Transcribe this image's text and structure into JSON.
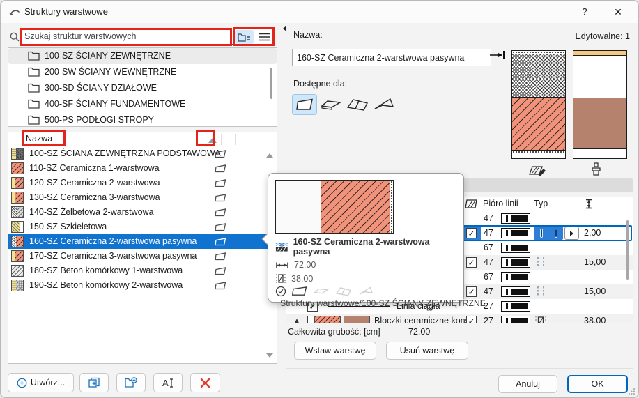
{
  "window": {
    "title": "Struktury warstwowe",
    "help_label": "?",
    "close_label": "✕"
  },
  "search": {
    "placeholder": "Szukaj struktur warstwowych"
  },
  "folder_tree": {
    "items": [
      {
        "label": "100-SZ ŚCIANY ZEWNĘTRZNE",
        "selected": true
      },
      {
        "label": "200-SW ŚCIANY WEWNĘTRZNE",
        "selected": false
      },
      {
        "label": "300-SD ŚCIANY DZIAŁOWE",
        "selected": false
      },
      {
        "label": "400-SF ŚCIANY FUNDAMENTOWE",
        "selected": false
      },
      {
        "label": "500-PS PODŁOGI STROPY",
        "selected": false
      }
    ]
  },
  "list": {
    "header": "Nazwa",
    "items": [
      {
        "name": "100-SZ ŚCIANA ZEWNĘTRZNA PODSTAWOWA",
        "pattern": "yellow-dark",
        "selected": false
      },
      {
        "name": "110-SZ Ceramiczna 1-warstwowa",
        "pattern": "salmon",
        "selected": false
      },
      {
        "name": "120-SZ Ceramiczna 2-warstwowa",
        "pattern": "yellow-salmon",
        "selected": false
      },
      {
        "name": "130-SZ Ceramiczna  3-warstwowa",
        "pattern": "yellow-salmon",
        "selected": false
      },
      {
        "name": "140-SZ Żelbetowa  2-warstwowa",
        "pattern": "mesh-gray",
        "selected": false
      },
      {
        "name": "150-SZ Szkieletowa",
        "pattern": "yellow-mesh",
        "selected": false
      },
      {
        "name": "160-SZ Ceramiczna 2-warstwowa pasywna",
        "pattern": "mesh-salmon",
        "selected": true
      },
      {
        "name": "170-SZ Ceramiczna 3-warstwowa pasywna",
        "pattern": "yellow-salmon",
        "selected": false
      },
      {
        "name": "180-SZ Beton komórkowy 1-warstwowa",
        "pattern": "gray-hatch",
        "selected": false
      },
      {
        "name": "190-SZ Beton komórkowy 2-warstwowa",
        "pattern": "yellow-gray",
        "selected": false
      }
    ]
  },
  "footer": {
    "create_label": "Utwórz..."
  },
  "right": {
    "name_label": "Nazwa:",
    "name_value": "160-SZ Ceramiczna 2-warstwowa pasywna",
    "editable_label": "Edytowalne: 1",
    "available_label": "Dostępne dla:",
    "table": {
      "pen_column": "Pióro linii",
      "type_column": "Typ",
      "rows": [
        {
          "kind": "line",
          "pen": "47",
          "name": "",
          "checked": false,
          "type": "",
          "thickness": "",
          "selected": false
        },
        {
          "kind": "layer",
          "pen": "47",
          "name": "",
          "checked": true,
          "type": "bars",
          "thickness": "2,00",
          "selected": true
        },
        {
          "kind": "line",
          "pen": "67",
          "name": "",
          "checked": false,
          "type": "",
          "thickness": "",
          "selected": false
        },
        {
          "kind": "layer",
          "pen": "47",
          "name": "",
          "checked": true,
          "type": "dots",
          "thickness": "15,00",
          "selected": false
        },
        {
          "kind": "line",
          "pen": "67",
          "name": "",
          "checked": false,
          "type": "",
          "thickness": "",
          "selected": false
        },
        {
          "kind": "layer",
          "pen": "47",
          "name": "",
          "checked": true,
          "type": "dots",
          "thickness": "15,00",
          "selected": false
        },
        {
          "kind": "line",
          "pen": "27",
          "name": "Linia ciągła",
          "checked": true,
          "type": "",
          "thickness": "",
          "selected": false
        },
        {
          "kind": "layer",
          "pen": "27",
          "name": "Bloczki ceramiczne konstr",
          "checked": true,
          "type": "hatch",
          "thickness": "38,00",
          "selected": false
        }
      ]
    },
    "total_label": "Całkowita grubość: [cm]",
    "total_value": "72,00",
    "insert_button": "Wstaw warstwę",
    "remove_button": "Usuń warstwę",
    "cancel_button": "Anuluj",
    "ok_button": "OK"
  },
  "tooltip": {
    "title": "160-SZ Ceramiczna 2-warstwowa pasywna",
    "width_value": "72,00",
    "core_value": "38,00",
    "path": "Struktury warstwowe/100-SZ ŚCIANY ZEWNĘTRZNE"
  },
  "colors": {
    "selection_blue": "#1173d0",
    "accent_blue": "#0067c0",
    "annotation_red": "#e1251b",
    "salmon": "#f0937a",
    "brown": "#b5826e",
    "yellow": "#f2e394",
    "tan": "#f5c884"
  }
}
